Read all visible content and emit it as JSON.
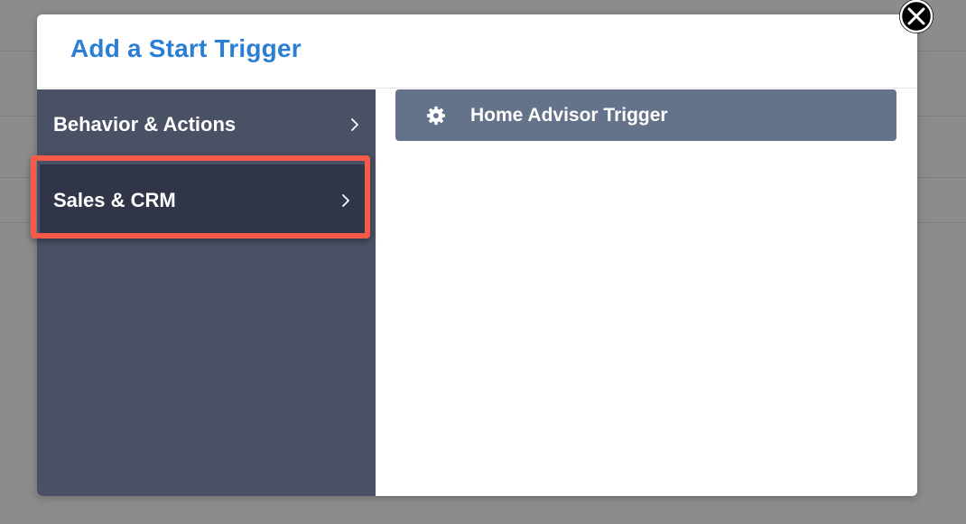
{
  "modal": {
    "title": "Add a Start Trigger"
  },
  "sidebar": {
    "items": [
      {
        "label": "Behavior & Actions",
        "icon": "chevron-right-icon"
      },
      {
        "label": "Sales & CRM",
        "icon": "chevron-right-icon",
        "selected": true
      }
    ]
  },
  "content": {
    "triggers": [
      {
        "label": "Home Advisor Trigger",
        "icon": "gear-icon"
      }
    ]
  },
  "colors": {
    "title": "#2a7fd4",
    "sidebar_bg": "#4b5165",
    "selected_bg": "#313548",
    "trigger_bg": "#647389",
    "highlight": "#f55a4b"
  }
}
